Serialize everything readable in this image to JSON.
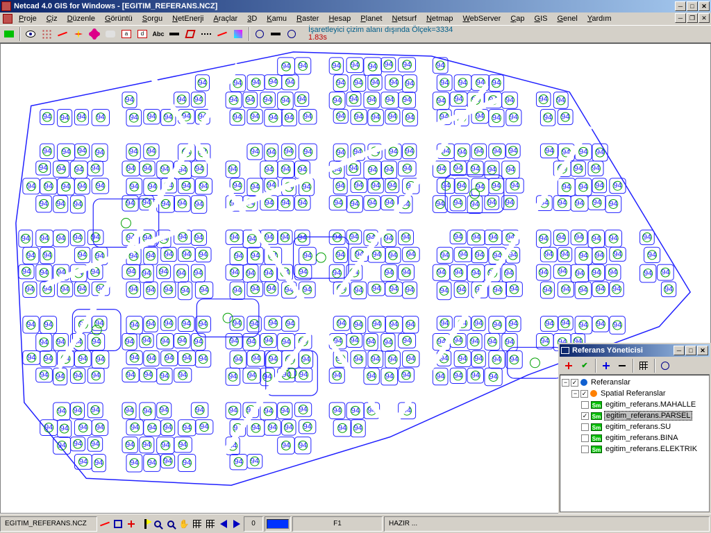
{
  "title": "Netcad 4.0 GIS for Windows - [EGITIM_REFERANS.NCZ]",
  "menus": [
    "Proje",
    "Çiz",
    "Düzenle",
    "Görüntü",
    "Sorgu",
    "NetEnerji",
    "Araçlar",
    "3D",
    "Kamu",
    "Raster",
    "Hesap",
    "Planet",
    "Netsurf",
    "Netmap",
    "WebServer",
    "Çap",
    "GIS",
    "Genel",
    "Yardım"
  ],
  "status_line1": "İşaretleyici çizim alanı dışında Ölçek=3334",
  "status_line2": "1.83s",
  "bottom": {
    "filename": "EGITIM_REFERANS.NCZ",
    "layer": "0",
    "fkey": "F1",
    "ready": "HAZIR ...",
    "swatch_color": "#0033ff"
  },
  "panel": {
    "title": "Referans Yöneticisi",
    "root": "Referanslar",
    "group": "Spatial Referanslar",
    "items": [
      {
        "label": "egitim_referans.MAHALLE",
        "checked": false,
        "selected": false
      },
      {
        "label": "egitim_referans.PARSEL",
        "checked": true,
        "selected": true
      },
      {
        "label": "egitim_referans.SU",
        "checked": false,
        "selected": false
      },
      {
        "label": "egitim_referans.BINA",
        "checked": false,
        "selected": false
      },
      {
        "label": "egitim_referans.ELEKTRIK",
        "checked": false,
        "selected": false
      }
    ]
  }
}
